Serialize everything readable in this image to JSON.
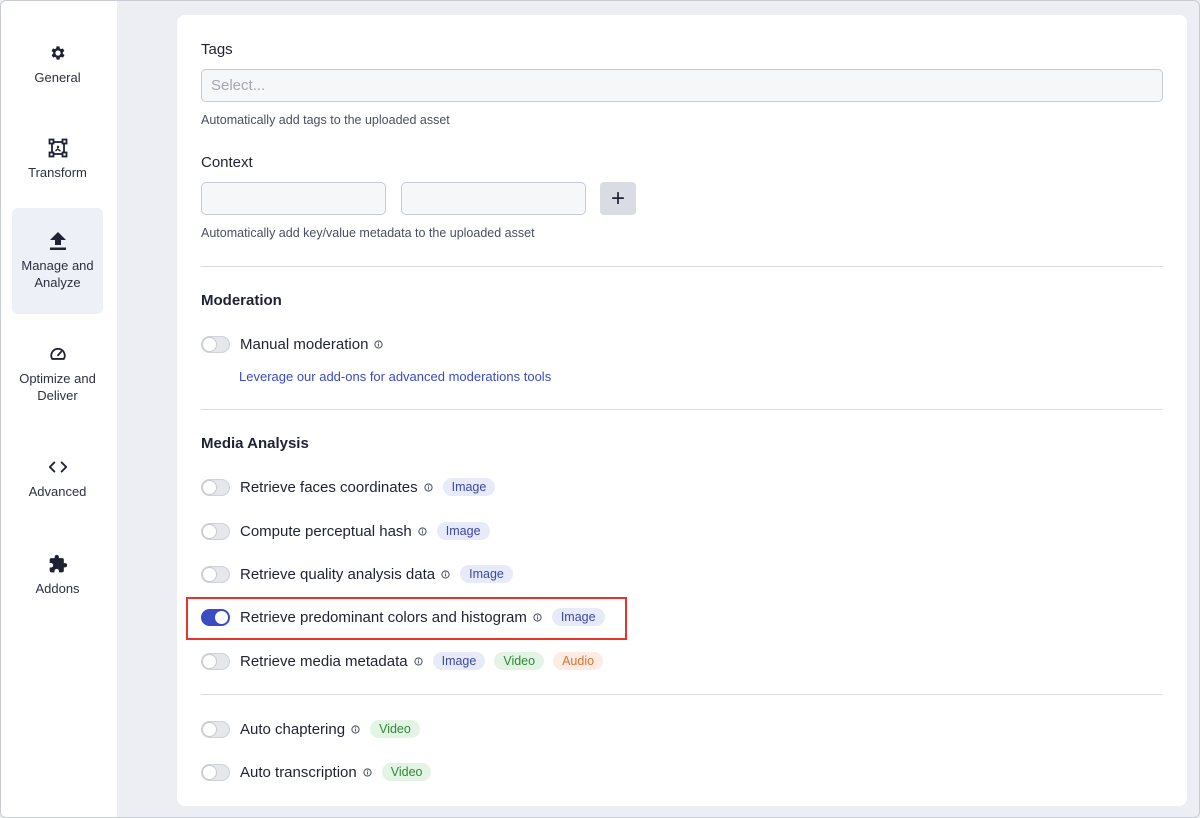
{
  "sidebar": {
    "items": [
      {
        "label": "General",
        "icon": "gear-icon"
      },
      {
        "label": "Transform",
        "icon": "transform-icon"
      },
      {
        "label": "Manage and Analyze",
        "icon": "upload-icon",
        "active": true
      },
      {
        "label": "Optimize and Deliver",
        "icon": "gauge-icon"
      },
      {
        "label": "Advanced",
        "icon": "code-icon"
      },
      {
        "label": "Addons",
        "icon": "puzzle-icon"
      }
    ]
  },
  "tags": {
    "label": "Tags",
    "placeholder": "Select...",
    "help": "Automatically add tags to the uploaded asset"
  },
  "context": {
    "label": "Context",
    "key_value": "",
    "value_value": "",
    "add_label": "+",
    "help": "Automatically add key/value metadata to the uploaded asset"
  },
  "moderation": {
    "title": "Moderation",
    "manual": {
      "label": "Manual moderation",
      "enabled": false
    },
    "link": "Leverage our add-ons for advanced moderations tools"
  },
  "media_analysis": {
    "title": "Media Analysis",
    "items": [
      {
        "label": "Retrieve faces coordinates",
        "enabled": false,
        "badges": [
          "Image"
        ]
      },
      {
        "label": "Compute perceptual hash",
        "enabled": false,
        "badges": [
          "Image"
        ]
      },
      {
        "label": "Retrieve quality analysis data",
        "enabled": false,
        "badges": [
          "Image"
        ]
      },
      {
        "label": "Retrieve predominant colors and histogram",
        "enabled": true,
        "badges": [
          "Image"
        ]
      },
      {
        "label": "Retrieve media metadata",
        "enabled": false,
        "badges": [
          "Image",
          "Video",
          "Audio"
        ]
      }
    ]
  },
  "video_features": {
    "items": [
      {
        "label": "Auto chaptering",
        "enabled": false,
        "badges": [
          "Video"
        ]
      },
      {
        "label": "Auto transcription",
        "enabled": false,
        "badges": [
          "Video"
        ]
      }
    ]
  },
  "colors": {
    "accent": "#3a4bc4",
    "highlight": "#e8352a",
    "image_badge": "#3b49a8",
    "video_badge": "#2e8a38",
    "audio_badge": "#e0712b"
  }
}
